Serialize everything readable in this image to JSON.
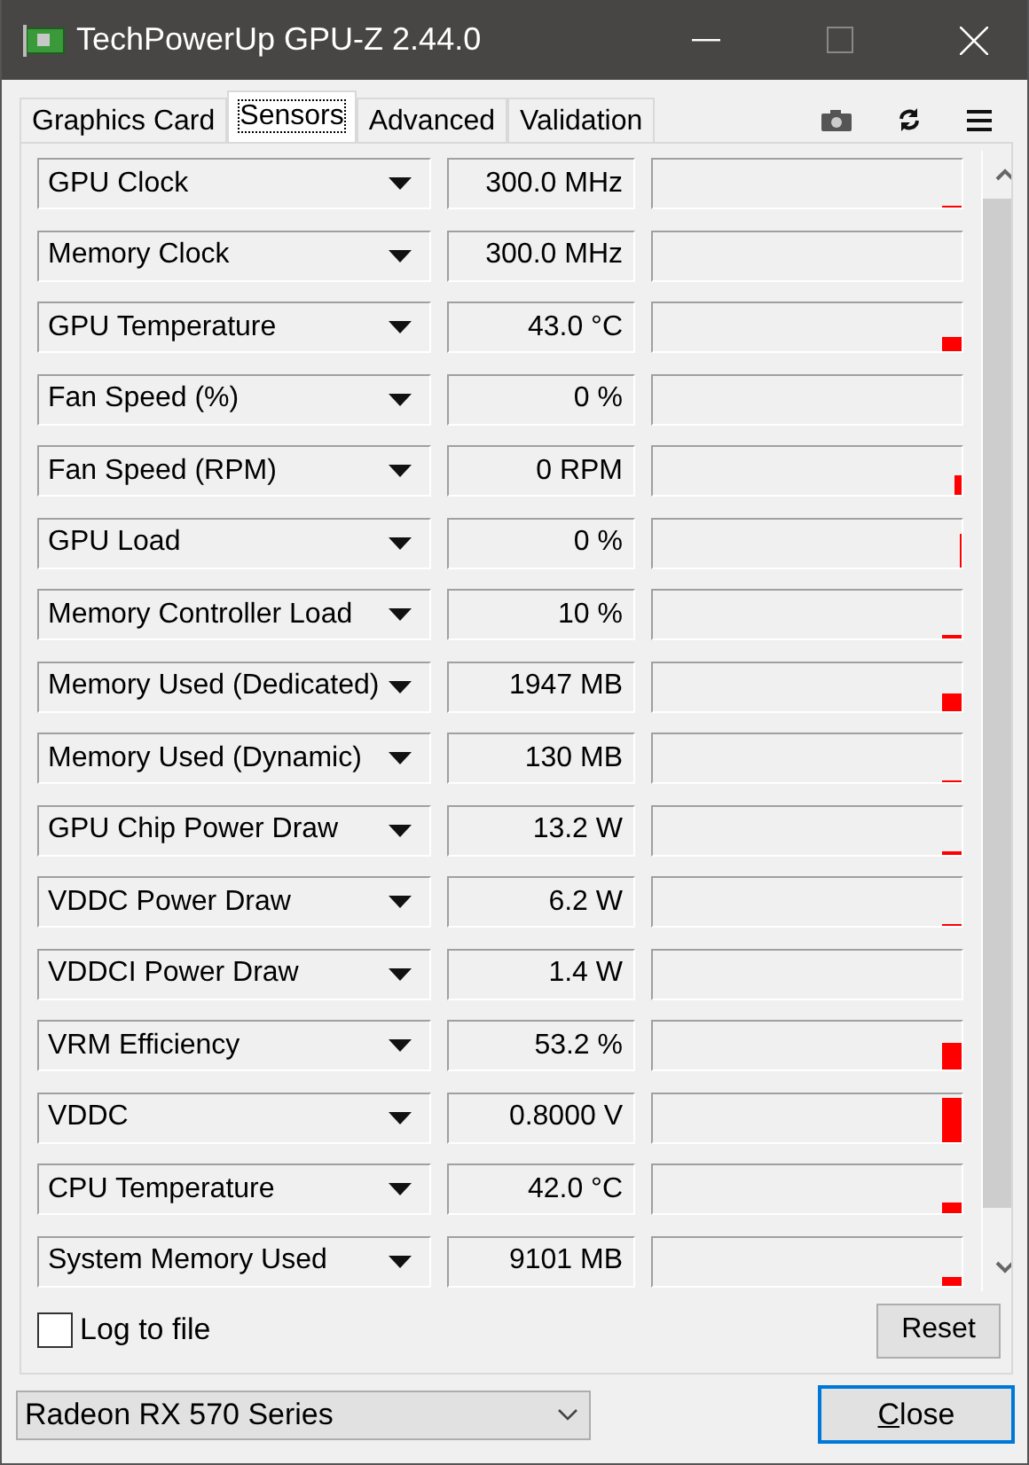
{
  "window": {
    "title": "TechPowerUp GPU-Z 2.44.0"
  },
  "tabs": [
    {
      "label": "Graphics Card",
      "selected": false
    },
    {
      "label": "Sensors",
      "selected": true
    },
    {
      "label": "Advanced",
      "selected": false
    },
    {
      "label": "Validation",
      "selected": false
    }
  ],
  "sensors": [
    {
      "name": "GPU Clock",
      "value": "300.0 MHz"
    },
    {
      "name": "Memory Clock",
      "value": "300.0 MHz"
    },
    {
      "name": "GPU Temperature",
      "value": "43.0 °C"
    },
    {
      "name": "Fan Speed (%)",
      "value": "0 %"
    },
    {
      "name": "Fan Speed (RPM)",
      "value": "0 RPM"
    },
    {
      "name": "GPU Load",
      "value": "0 %"
    },
    {
      "name": "Memory Controller Load",
      "value": "10 %"
    },
    {
      "name": "Memory Used (Dedicated)",
      "value": "1947 MB"
    },
    {
      "name": "Memory Used (Dynamic)",
      "value": "130 MB"
    },
    {
      "name": "GPU Chip Power Draw",
      "value": "13.2 W"
    },
    {
      "name": "VDDC Power Draw",
      "value": "6.2 W"
    },
    {
      "name": "VDDCI Power Draw",
      "value": "1.4 W"
    },
    {
      "name": "VRM Efficiency",
      "value": "53.2 %"
    },
    {
      "name": "VDDC",
      "value": "0.8000 V"
    },
    {
      "name": "CPU Temperature",
      "value": "42.0 °C"
    },
    {
      "name": "System Memory Used",
      "value": "9101 MB"
    }
  ],
  "log_to_file": {
    "label": "Log to file",
    "checked": false
  },
  "reset_button": "Reset",
  "gpu_select": {
    "value": "Radeon RX 570 Series"
  },
  "close_button": "Close"
}
